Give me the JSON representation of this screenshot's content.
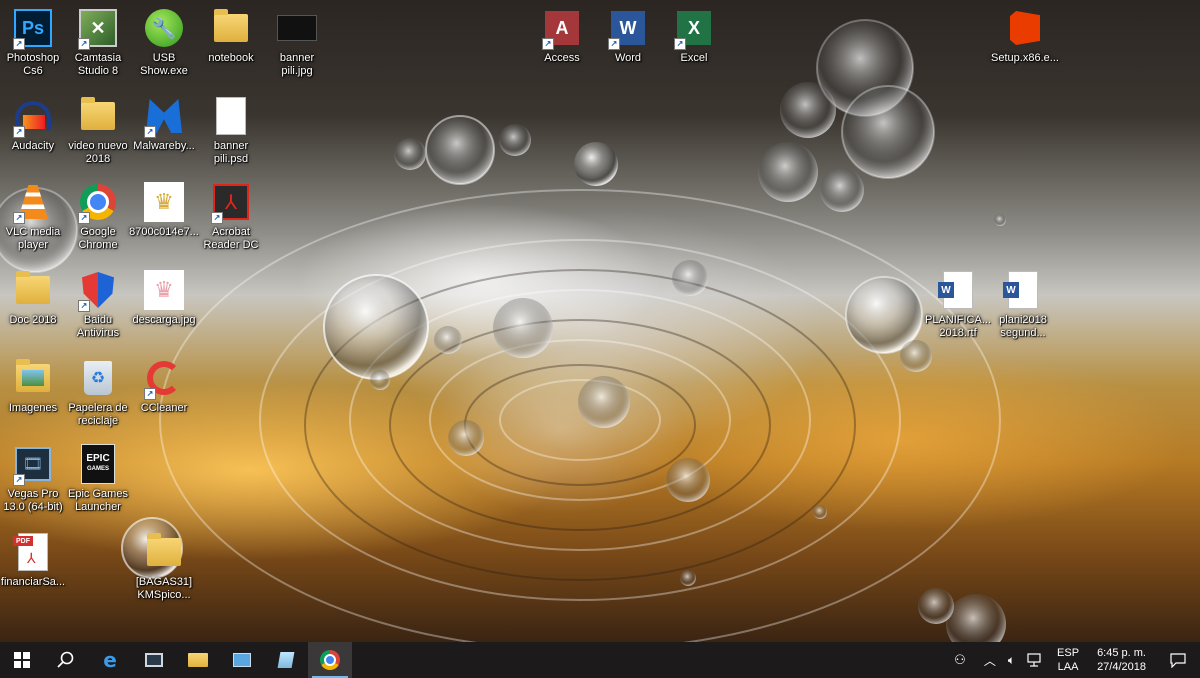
{
  "desktop": {
    "icons": [
      {
        "name": "photoshop",
        "label": "Photoshop\nCs6"
      },
      {
        "name": "camtasia",
        "label": "Camtasia\nStudio 8"
      },
      {
        "name": "usb-show",
        "label": "USB\nShow.exe"
      },
      {
        "name": "notebook",
        "label": "notebook"
      },
      {
        "name": "banner-jpg",
        "label": "banner\npili.jpg"
      },
      {
        "name": "access",
        "label": "Access"
      },
      {
        "name": "word",
        "label": "Word"
      },
      {
        "name": "excel",
        "label": "Excel"
      },
      {
        "name": "setup",
        "label": "Setup.x86.e..."
      },
      {
        "name": "audacity",
        "label": "Audacity"
      },
      {
        "name": "video-nuevo",
        "label": "video nuevo\n2018"
      },
      {
        "name": "malwarebytes",
        "label": "Malwareby..."
      },
      {
        "name": "banner-psd",
        "label": "banner\npili.psd"
      },
      {
        "name": "vlc",
        "label": "VLC media\nplayer"
      },
      {
        "name": "chrome",
        "label": "Google\nChrome"
      },
      {
        "name": "img-8700",
        "label": "8700c014e7..."
      },
      {
        "name": "acrobat",
        "label": "Acrobat\nReader DC"
      },
      {
        "name": "planifica",
        "label": "PLANIFICA...\n2018.rtf"
      },
      {
        "name": "plani2018",
        "label": "plani2018\nsegund..."
      },
      {
        "name": "doc2018",
        "label": "Doc 2018"
      },
      {
        "name": "baidu",
        "label": "Baidu\nAntivirus"
      },
      {
        "name": "descarga",
        "label": "descarga.jpg"
      },
      {
        "name": "imagenes",
        "label": "Imagenes"
      },
      {
        "name": "papelera",
        "label": "Papelera de\nreciclaje"
      },
      {
        "name": "ccleaner",
        "label": "CCleaner"
      },
      {
        "name": "vegas",
        "label": "Vegas Pro\n13.0 (64-bit)"
      },
      {
        "name": "epic",
        "label": "Epic Games\nLauncher"
      },
      {
        "name": "financiar",
        "label": "financiarSa..."
      },
      {
        "name": "bagas",
        "label": "[BAGAS31]\nKMSpico..."
      }
    ]
  },
  "taskbar": {
    "language": {
      "line1": "ESP",
      "line2": "LAA"
    },
    "clock": {
      "time": "6:45 p. m.",
      "date": "27/4/2018"
    },
    "pinned": [
      "start",
      "search",
      "edge",
      "media",
      "explorer",
      "control-panel",
      "notepad",
      "chrome"
    ]
  },
  "colors": {
    "taskbar": "#1c1a1b",
    "accent": "#76b9ed"
  }
}
